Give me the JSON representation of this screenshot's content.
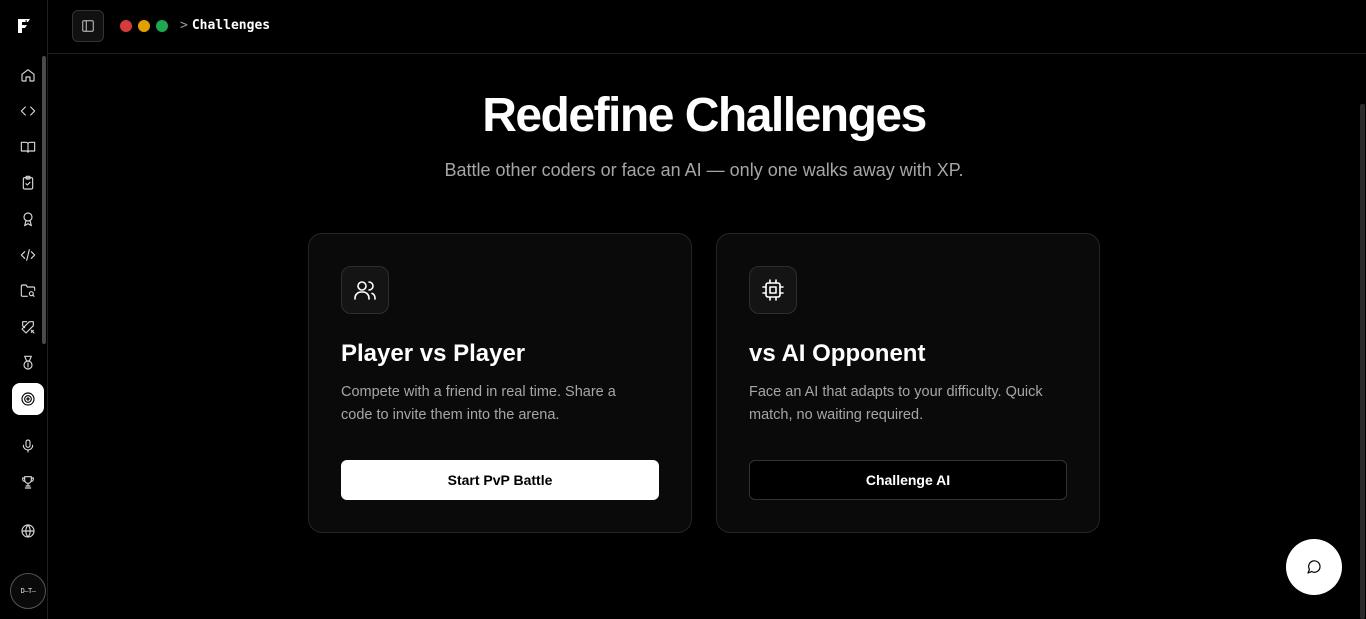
{
  "colors": {
    "traffic_red": "#d63b3b",
    "traffic_yellow": "#e0a100",
    "traffic_green": "#1fa84f",
    "background": "#000000",
    "card_bg": "#0a0a0a"
  },
  "sidebar": {
    "logo_icon": "flame-f-logo-icon",
    "items": [
      {
        "icon": "home-icon",
        "active": false
      },
      {
        "icon": "code-brackets-icon",
        "active": false
      },
      {
        "icon": "book-open-icon",
        "active": false
      },
      {
        "icon": "clipboard-check-icon",
        "active": false
      },
      {
        "icon": "award-icon",
        "active": false
      },
      {
        "icon": "code-slash-icon",
        "active": false
      },
      {
        "icon": "folder-search-icon",
        "active": false
      },
      {
        "icon": "swords-icon",
        "active": false
      },
      {
        "icon": "medal-icon",
        "active": false
      },
      {
        "icon": "target-icon",
        "active": true
      },
      {
        "icon": "microphone-icon",
        "active": false
      },
      {
        "icon": "trophy-icon",
        "active": false
      },
      {
        "icon": "globe-icon",
        "active": false
      }
    ],
    "avatar_text": "D—T—"
  },
  "topbar": {
    "breadcrumb_sep": ">",
    "breadcrumb_current": "Challenges"
  },
  "hero": {
    "title": "Redefine Challenges",
    "subtitle": "Battle other coders or face an AI — only one walks away with XP."
  },
  "cards": [
    {
      "icon": "users-icon",
      "title": "Player vs Player",
      "description": "Compete with a friend in real time. Share a code to invite them into the arena.",
      "button": "Start PvP Battle"
    },
    {
      "icon": "cpu-icon",
      "title": "vs AI Opponent",
      "description": "Face an AI that adapts to your difficulty. Quick match, no waiting required.",
      "button": "Challenge AI"
    }
  ],
  "chat_button_icon": "chat-bubble-icon"
}
